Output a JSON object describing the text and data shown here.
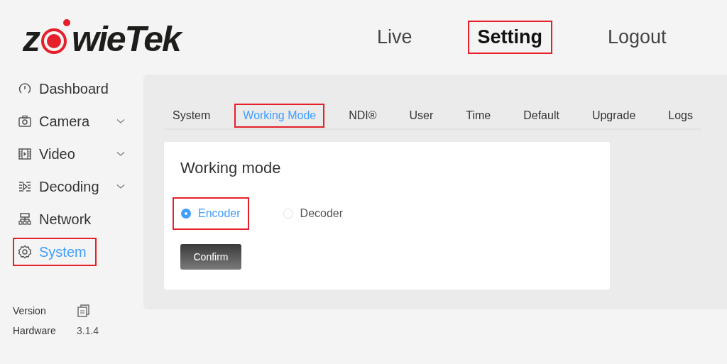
{
  "logo": {
    "start": "z",
    "end": "wieTek"
  },
  "nav": [
    {
      "label": "Live",
      "selected": false,
      "highlighted": false
    },
    {
      "label": "Setting",
      "selected": true,
      "highlighted": true
    },
    {
      "label": "Logout",
      "selected": false,
      "highlighted": false
    }
  ],
  "sidebar": {
    "items": [
      {
        "label": "Dashboard",
        "expandable": false,
        "selected": false,
        "highlighted": false
      },
      {
        "label": "Camera",
        "expandable": true,
        "selected": false,
        "highlighted": false
      },
      {
        "label": "Video",
        "expandable": true,
        "selected": false,
        "highlighted": false
      },
      {
        "label": "Decoding",
        "expandable": true,
        "selected": false,
        "highlighted": false
      },
      {
        "label": "Network",
        "expandable": false,
        "selected": false,
        "highlighted": false
      },
      {
        "label": "System",
        "expandable": false,
        "selected": true,
        "highlighted": true
      }
    ],
    "info": [
      {
        "label": "Version",
        "kind": "copy"
      },
      {
        "label": "Hardware",
        "kind": "value",
        "value": "3.1.4"
      }
    ]
  },
  "tabs": [
    {
      "label": "System",
      "selected": false,
      "highlighted": false
    },
    {
      "label": "Working Mode",
      "selected": true,
      "highlighted": true
    },
    {
      "label": "NDI®",
      "selected": false,
      "highlighted": false
    },
    {
      "label": "User",
      "selected": false,
      "highlighted": false
    },
    {
      "label": "Time",
      "selected": false,
      "highlighted": false
    },
    {
      "label": "Default",
      "selected": false,
      "highlighted": false
    },
    {
      "label": "Upgrade",
      "selected": false,
      "highlighted": false
    },
    {
      "label": "Logs",
      "selected": false,
      "highlighted": false
    }
  ],
  "card": {
    "title": "Working mode",
    "options": [
      {
        "label": "Encoder",
        "selected": true,
        "highlighted": true
      },
      {
        "label": "Decoder",
        "selected": false,
        "highlighted": false
      }
    ],
    "button": "Confirm"
  }
}
